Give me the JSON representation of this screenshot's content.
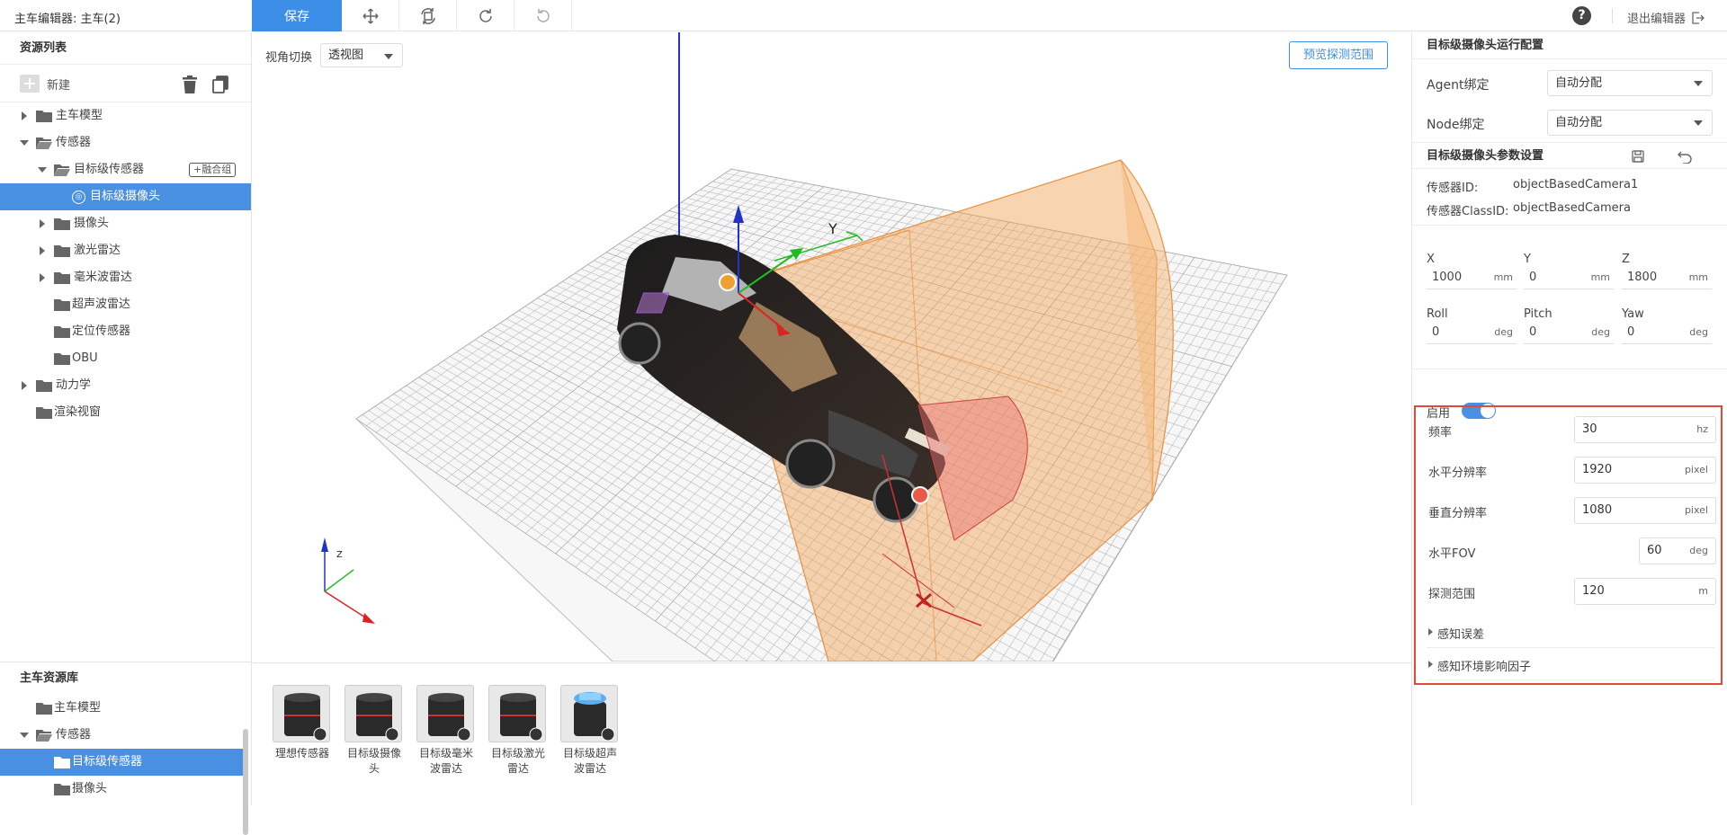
{
  "app": {
    "title": "主车编辑器: 主车(2)",
    "save": "保存",
    "exit": "退出编辑器"
  },
  "resources": {
    "title": "资源列表",
    "new": "新建",
    "tree": [
      {
        "label": "主车模型"
      },
      {
        "label": "传感器"
      },
      {
        "label": "目标级传感器",
        "badge": "+融合组"
      },
      {
        "label": "目标级摄像头"
      },
      {
        "label": "摄像头"
      },
      {
        "label": "激光雷达"
      },
      {
        "label": "毫米波雷达"
      },
      {
        "label": "超声波雷达"
      },
      {
        "label": "定位传感器"
      },
      {
        "label": "OBU"
      },
      {
        "label": "动力学"
      },
      {
        "label": "渲染视窗"
      }
    ]
  },
  "library": {
    "title": "主车资源库",
    "tree": [
      {
        "label": "主车模型"
      },
      {
        "label": "传感器"
      },
      {
        "label": "目标级传感器"
      },
      {
        "label": "摄像头"
      }
    ]
  },
  "viewport": {
    "view_label": "视角切换",
    "view_value": "透视图",
    "preview": "预览探测范围",
    "axis_labels": {
      "y": "Y",
      "z": "Z"
    }
  },
  "sensors": [
    {
      "label": "理想传感器"
    },
    {
      "label": "目标级摄像头"
    },
    {
      "label": "目标级毫米波雷达"
    },
    {
      "label": "目标级激光雷达"
    },
    {
      "label": "目标级超声波雷达"
    }
  ],
  "run_config": {
    "title": "目标级摄像头运行配置",
    "agent_label": "Agent绑定",
    "agent_value": "自动分配",
    "node_label": "Node绑定",
    "node_value": "自动分配"
  },
  "params": {
    "title": "目标级摄像头参数设置",
    "sensor_id_label": "传感器ID:",
    "sensor_id": "objectBasedCamera1",
    "class_id_label": "传感器ClassID:",
    "class_id": "objectBasedCamera",
    "x_label": "X",
    "x": "1000",
    "x_unit": "mm",
    "y_label": "Y",
    "y": "0",
    "y_unit": "mm",
    "z_label": "Z",
    "z": "1800",
    "z_unit": "mm",
    "roll_label": "Roll",
    "roll": "0",
    "roll_unit": "deg",
    "pitch_label": "Pitch",
    "pitch": "0",
    "pitch_unit": "deg",
    "yaw_label": "Yaw",
    "yaw": "0",
    "yaw_unit": "deg",
    "enable_label": "启用",
    "freq_label": "频率",
    "freq": "30",
    "freq_unit": "hz",
    "hres_label": "水平分辨率",
    "hres": "1920",
    "hres_unit": "pixel",
    "vres_label": "垂直分辨率",
    "vres": "1080",
    "vres_unit": "pixel",
    "fov_label": "水平FOV",
    "fov": "60",
    "fov_unit": "deg",
    "range_label": "探测范围",
    "range": "120",
    "range_unit": "m",
    "perception_error": "感知误差",
    "env_factor": "感知环境影响因子"
  },
  "colors": {
    "accent": "#3d8ee6",
    "selected": "#4a90e2",
    "highlight": "#e04a3a",
    "fov": "#f0a050"
  }
}
